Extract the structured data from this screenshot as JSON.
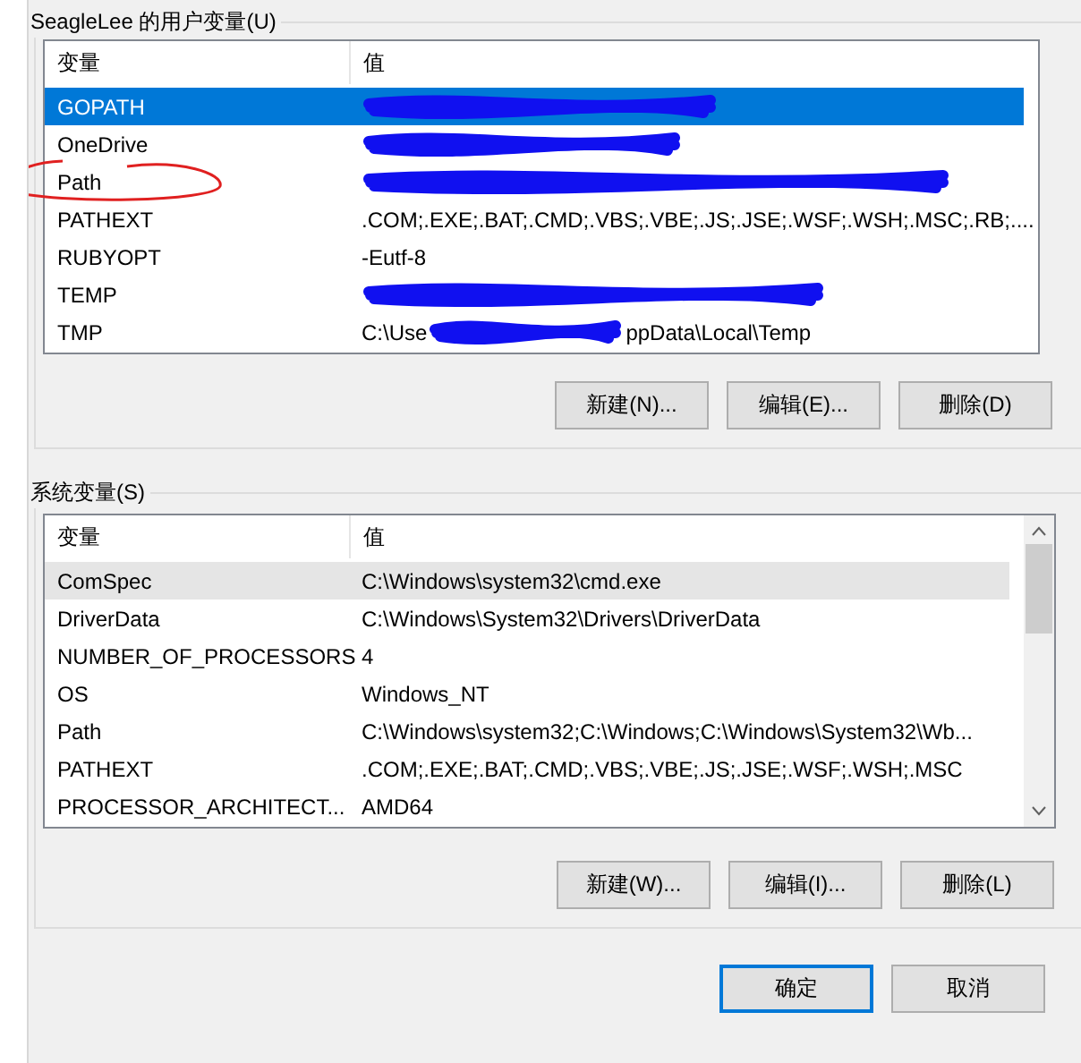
{
  "user_vars": {
    "title": "SeagleLee 的用户变量(U)",
    "columns": [
      "变量",
      "值"
    ],
    "rows": [
      {
        "name": "GOPATH",
        "selected": true,
        "circled": false,
        "redacted": true
      },
      {
        "name": "OneDrive",
        "selected": false,
        "circled": false,
        "redacted": true
      },
      {
        "name": "Path",
        "selected": false,
        "circled": true,
        "redacted": true
      },
      {
        "name": "PATHEXT",
        "selected": false,
        "circled": false,
        "redacted": false,
        "value": ".COM;.EXE;.BAT;.CMD;.VBS;.VBE;.JS;.JSE;.WSF;.WSH;.MSC;.RB;...."
      },
      {
        "name": "RUBYOPT",
        "selected": false,
        "circled": false,
        "redacted": false,
        "value": "-Eutf-8"
      },
      {
        "name": "TEMP",
        "selected": false,
        "circled": false,
        "redacted": true
      },
      {
        "name": "TMP",
        "selected": false,
        "circled": false,
        "redacted": true,
        "value": "C:\\Use",
        "value_after": "ppData\\Local\\Temp"
      }
    ],
    "buttons": [
      "新建(N)...",
      "编辑(E)...",
      "删除(D)"
    ]
  },
  "system_vars": {
    "title": "系统变量(S)",
    "columns": [
      "变量",
      "值"
    ],
    "rows": [
      {
        "name": "ComSpec",
        "selected": true,
        "value": "C:\\Windows\\system32\\cmd.exe"
      },
      {
        "name": "DriverData",
        "selected": false,
        "value": "C:\\Windows\\System32\\Drivers\\DriverData"
      },
      {
        "name": "NUMBER_OF_PROCESSORS",
        "selected": false,
        "value": "4"
      },
      {
        "name": "OS",
        "selected": false,
        "value": "Windows_NT"
      },
      {
        "name": "Path",
        "selected": false,
        "value": "C:\\Windows\\system32;C:\\Windows;C:\\Windows\\System32\\Wb..."
      },
      {
        "name": "PATHEXT",
        "selected": false,
        "value": ".COM;.EXE;.BAT;.CMD;.VBS;.VBE;.JS;.JSE;.WSF;.WSH;.MSC"
      },
      {
        "name": "PROCESSOR_ARCHITECT...",
        "selected": false,
        "value": "AMD64"
      }
    ],
    "buttons": [
      "新建(W)...",
      "编辑(I)...",
      "删除(L)"
    ]
  },
  "footer_buttons": [
    {
      "label": "确定",
      "default": true
    },
    {
      "label": "取消",
      "default": false
    }
  ]
}
